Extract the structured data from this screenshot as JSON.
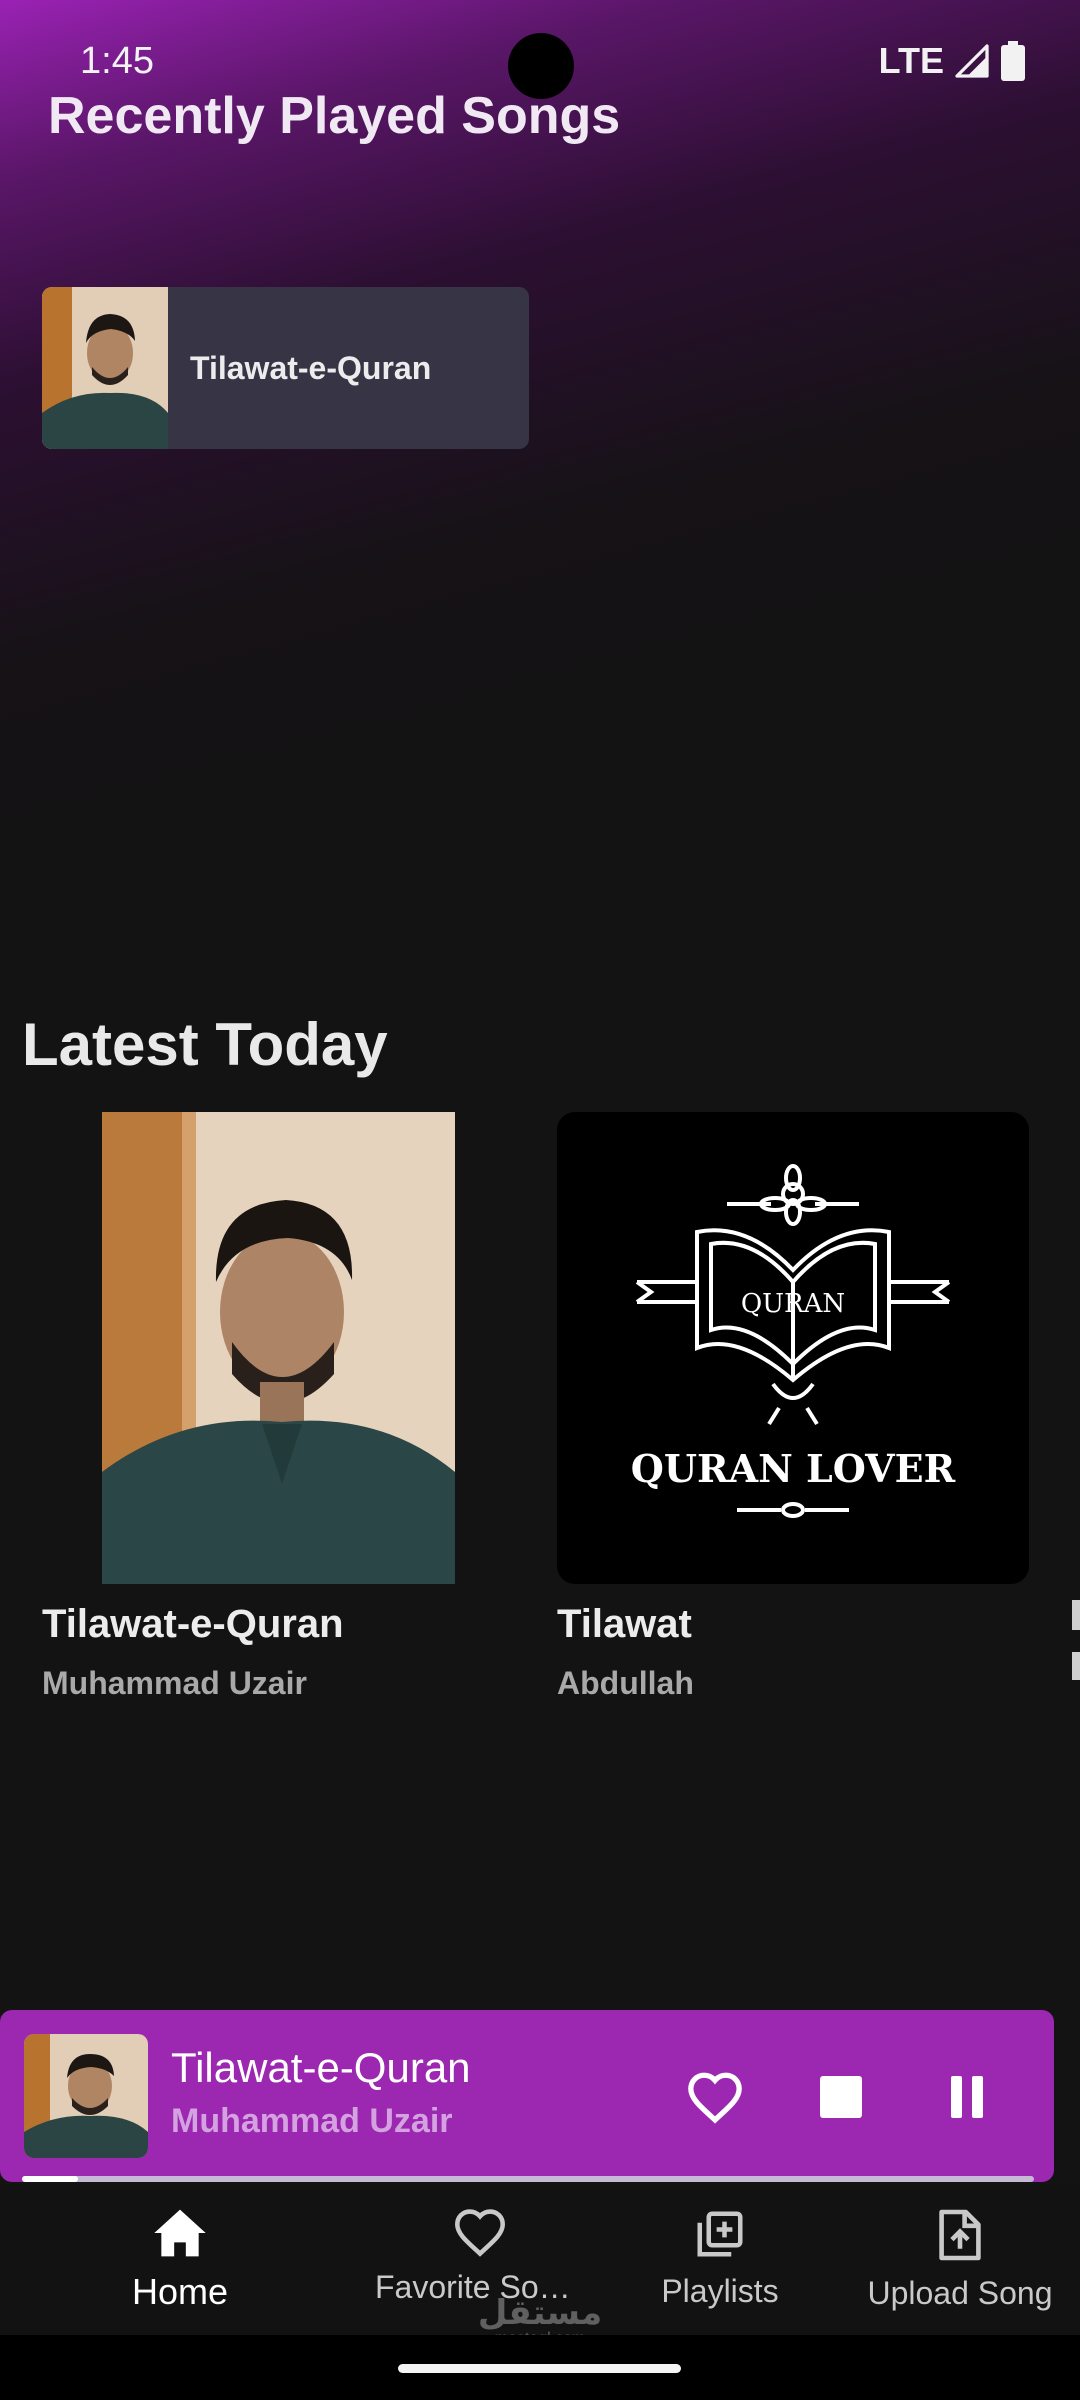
{
  "status_bar": {
    "time": "1:45",
    "network": "LTE",
    "signal_icon": "signal-icon",
    "battery_icon": "battery-icon"
  },
  "recently_played": {
    "title": "Recently Played Songs",
    "items": [
      {
        "title": "Tilawat-e-Quran"
      }
    ]
  },
  "latest_today": {
    "title": "Latest Today",
    "items": [
      {
        "title": "Tilawat-e-Quran",
        "artist": "Muhammad Uzair"
      },
      {
        "title": "Tilawat",
        "artist": "Abdullah",
        "art_text_top": "QURAN",
        "art_text_bottom": "QURAN LOVER"
      }
    ]
  },
  "now_playing": {
    "title": "Tilawat-e-Quran",
    "artist": "Muhammad Uzair",
    "progress": 0.055,
    "buttons": [
      "heart-icon",
      "stop-icon",
      "pause-icon"
    ]
  },
  "bottom_nav": {
    "items": [
      {
        "label": "Home",
        "icon": "home-icon",
        "active": true
      },
      {
        "label": "Favorite Songs",
        "icon": "heart-outline-icon",
        "active": false
      },
      {
        "label": "Playlists",
        "icon": "playlist-add-icon",
        "active": false
      },
      {
        "label": "Upload Song",
        "icon": "upload-file-icon",
        "active": false
      }
    ]
  },
  "watermark": {
    "text_ar": "مستقل",
    "url": "mostaql.com"
  },
  "colors": {
    "accent": "#9c27b0",
    "background": "#131313",
    "card": "#373545"
  }
}
